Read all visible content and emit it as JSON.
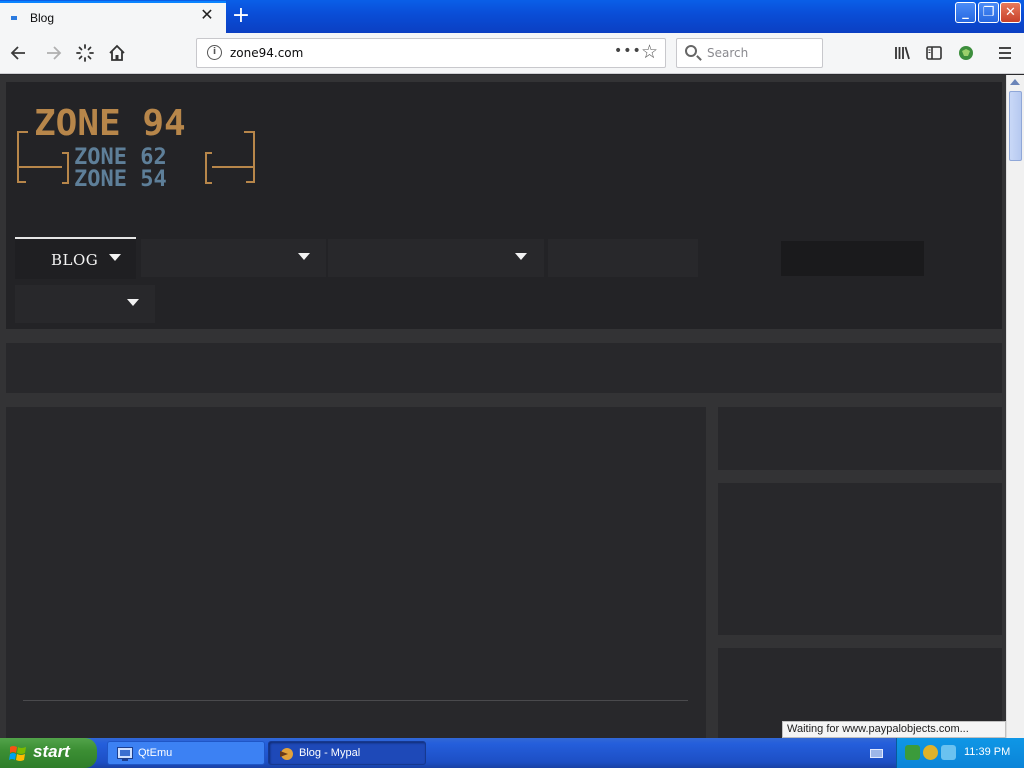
{
  "browser": {
    "tab_title": "Blog",
    "url": "zone94.com",
    "search_placeholder": "Search",
    "status_text": "Waiting for www.paypalobjects.com..."
  },
  "site": {
    "logo": {
      "primary": "ZONE 94",
      "secondary": "ZONE 62",
      "tertiary": "ZONE 54"
    },
    "nav": {
      "active_label": "BLOG"
    }
  },
  "taskbar": {
    "start_label": "start",
    "tasks": [
      {
        "label": "QtEmu"
      },
      {
        "label": "Blog - Mypal"
      }
    ],
    "clock": "11:39 PM"
  },
  "colors": {
    "logo_gold": "#b7864a",
    "logo_blue": "#5e7f99",
    "page_bg": "#333335"
  }
}
